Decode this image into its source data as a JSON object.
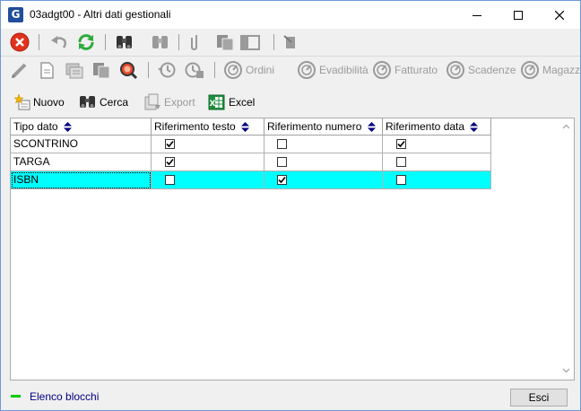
{
  "window": {
    "title": "03adgt00 - Altri dati gestionali",
    "icon_letter": "G",
    "app_icon": "app-logo-icon"
  },
  "toolbar2": {
    "ordini": "Ordini",
    "evadibilita": "Evadibilità",
    "fatturato": "Fatturato",
    "scadenze": "Scadenze",
    "magazzino": "Magazzino"
  },
  "actions": {
    "nuovo": "Nuovo",
    "cerca": "Cerca",
    "export": "Export",
    "excel": "Excel"
  },
  "grid": {
    "columns": [
      "Tipo dato",
      "Riferimento testo",
      "Riferimento numero",
      "Riferimento data"
    ],
    "rows": [
      {
        "tipo": "SCONTRINO",
        "testo": true,
        "numero": false,
        "data": true,
        "selected": false
      },
      {
        "tipo": "TARGA",
        "testo": true,
        "numero": false,
        "data": false,
        "selected": false
      },
      {
        "tipo": "ISBN",
        "testo": false,
        "numero": true,
        "data": false,
        "selected": true
      }
    ]
  },
  "status": {
    "text": "Elenco blocchi",
    "led_color": "#00cc00"
  },
  "footer": {
    "esci": "Esci"
  },
  "colors": {
    "selection": "#00ffff",
    "status_text": "#000080",
    "disabled": "#9b9b9b"
  }
}
